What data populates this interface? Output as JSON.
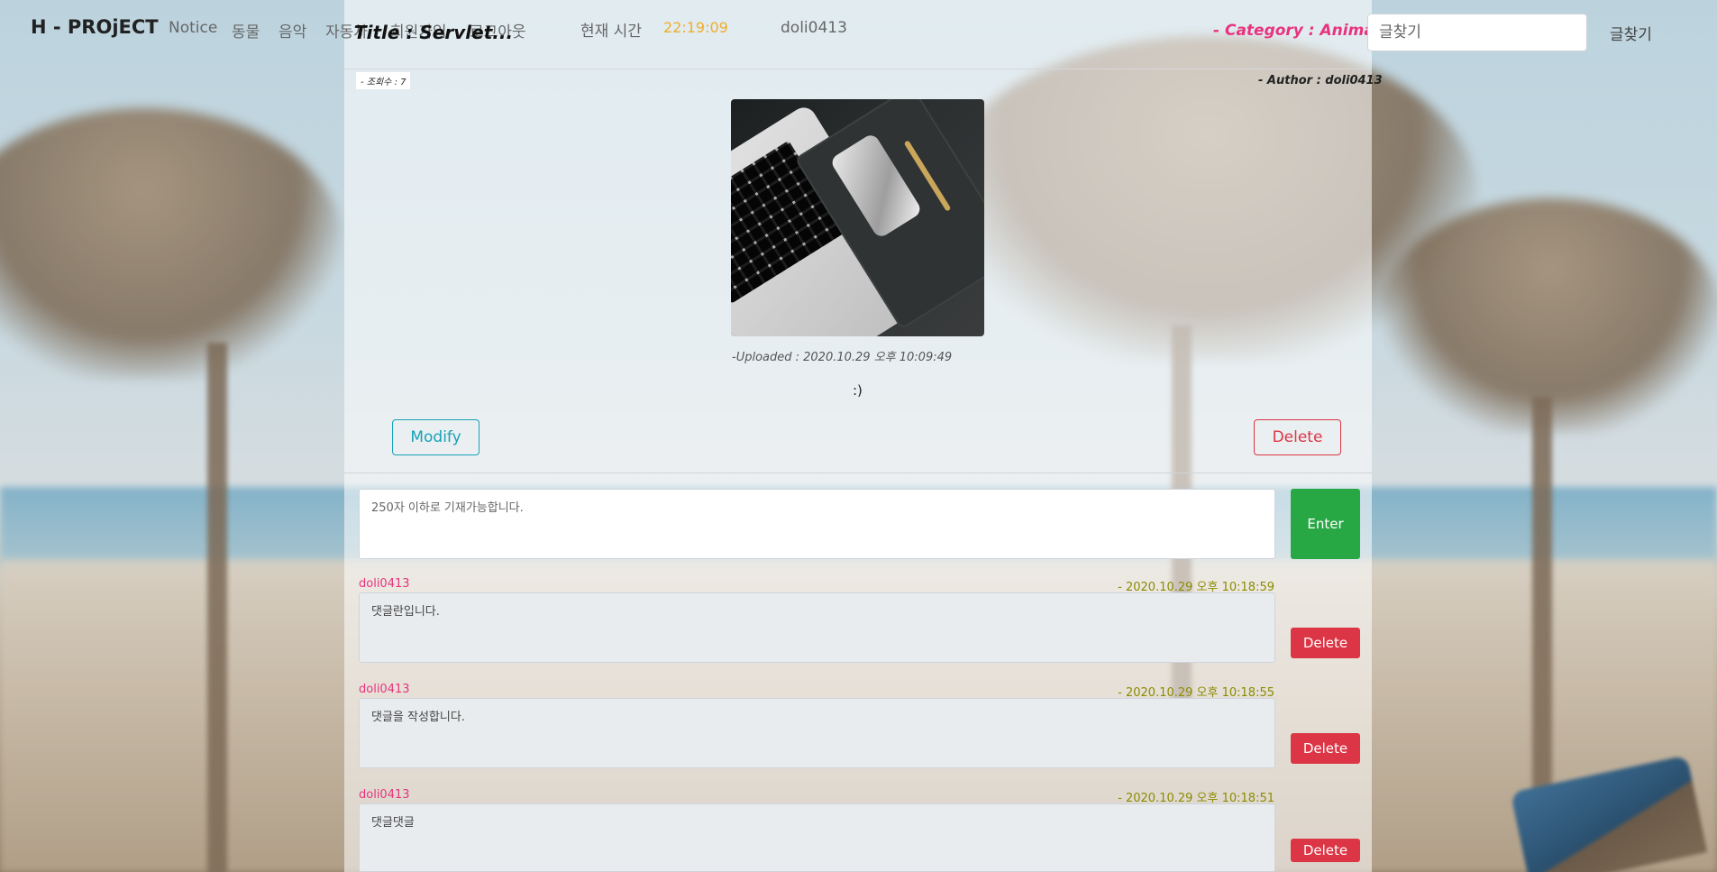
{
  "navbar": {
    "brand": "H - PROjECT",
    "items": [
      "Notice",
      "동물",
      "음악",
      "자동차",
      "회원가입",
      "로그아웃"
    ],
    "clock_label": "현재 시간",
    "clock_value": "22:19:09",
    "username": "doli0413",
    "search_placeholder": "글찾기",
    "search_button": "글찾기"
  },
  "post": {
    "title": "Title : Servlet...",
    "category": "- Category : Animals",
    "views": "- 조회수 : 7",
    "author": "- Author : doli0413",
    "uploaded": "-Uploaded : 2020.10.29 오후 10:09:49",
    "content": ":)",
    "modify_label": "Modify",
    "delete_label": "Delete"
  },
  "comment_form": {
    "placeholder": "250자 이하로 기재가능합니다.",
    "enter_label": "Enter"
  },
  "comments": [
    {
      "author": "doli0413",
      "date": "- 2020.10.29 오후 10:18:59",
      "text": "댓글란입니다.",
      "delete_label": "Delete"
    },
    {
      "author": "doli0413",
      "date": "- 2020.10.29 오후 10:18:55",
      "text": "댓글을 작성합니다.",
      "delete_label": "Delete"
    },
    {
      "author": "doli0413",
      "date": "- 2020.10.29 오후 10:18:51",
      "text": "댓글댓글",
      "delete_label": "Delete"
    }
  ],
  "colors": {
    "accent_pink": "#e8337f",
    "clock_orange": "#f0ad2c",
    "success_green": "#28a745",
    "danger_red": "#dc3545",
    "info_teal": "#17a2b8"
  }
}
